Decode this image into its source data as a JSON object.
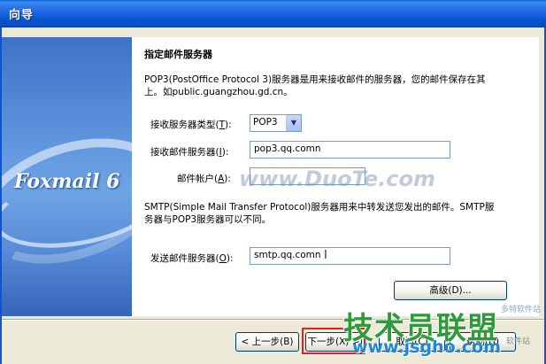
{
  "window": {
    "title": "向导"
  },
  "banner": {
    "logo": "Foxmail 6"
  },
  "page": {
    "heading": "指定邮件服务器",
    "pop3_desc_line1": "POP3(PostOffice Protocol 3)服务器是用来接收邮件的服务器，您的邮件保存在其",
    "pop3_desc_line2": "上。如public.guangzhou.gd.cn。",
    "smtp_desc_line1": "SMTP(Simple Mail Transfer Protocol)服务器用来中转发送您发出的邮件。SMTP服",
    "smtp_desc_line2": "务器与POP3服务器可以不同。"
  },
  "fields": {
    "server_type": {
      "label": "接收服务器类型",
      "accel": "T",
      "value": "POP3"
    },
    "incoming": {
      "label": "接收邮件服务器",
      "accel": "I",
      "value": "pop3.qq.comn"
    },
    "account": {
      "label": "邮件帐户",
      "accel": "A",
      "value": ""
    },
    "outgoing": {
      "label": "发送邮件服务器",
      "accel": "O",
      "value": "smtp.qq.comn"
    }
  },
  "buttons": {
    "advanced": "高级(D)...",
    "back": "< 上一步(B)",
    "next": "下一步(X) >",
    "cancel": "取消(C)",
    "help": "帮助(H)"
  },
  "watermarks": {
    "duote": "www.DuoTe.com",
    "site_cn": "技术员联盟",
    "site_url": "www.jsgho.com",
    "corner_top": "多特软件站",
    "corner_bottom": "软件站"
  },
  "colors": {
    "title_bar": "#0b55d4",
    "highlight_box": "#e52020"
  }
}
